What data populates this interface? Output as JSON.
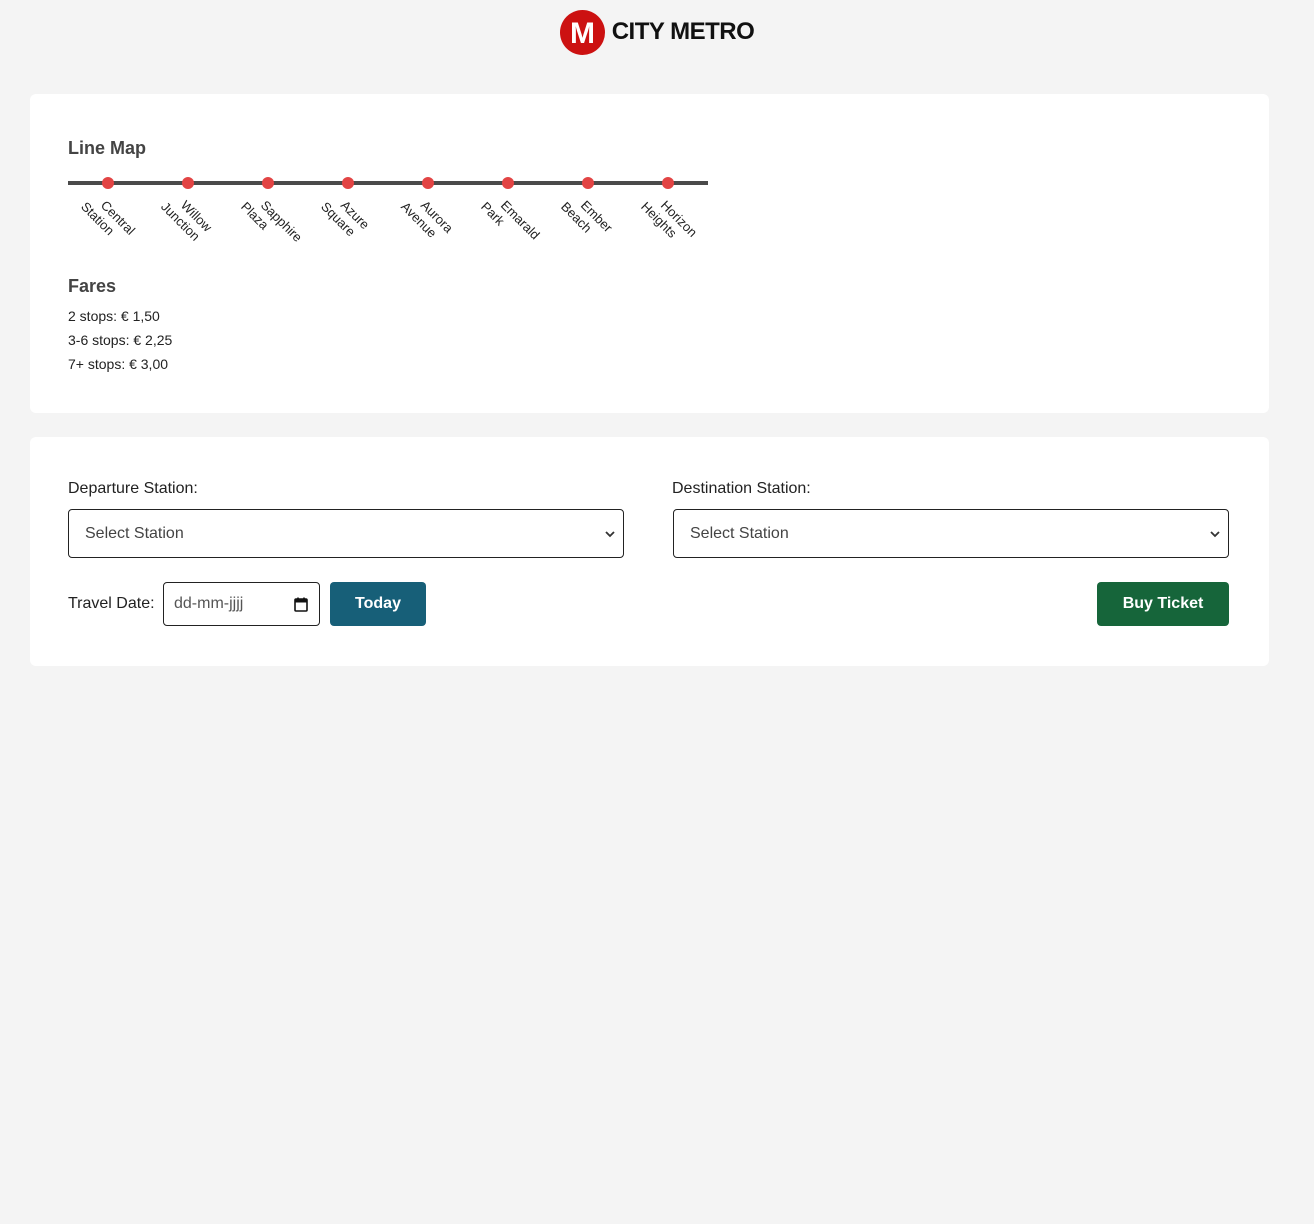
{
  "header": {
    "logo_letter": "M",
    "brand": "CITY METRO"
  },
  "line_map": {
    "title": "Line Map",
    "line_color": "#4a4a4a",
    "stop_color": "#e24444",
    "stations": [
      [
        "Central",
        "Station"
      ],
      [
        "Willow",
        "Junction"
      ],
      [
        "Sapphire",
        "Plaza"
      ],
      [
        "Azure",
        "Square"
      ],
      [
        "Aurora",
        "Avenue"
      ],
      [
        "Emarald",
        "Park"
      ],
      [
        "Ember",
        "Beach"
      ],
      [
        "Horizon",
        "Heights"
      ]
    ]
  },
  "fares": {
    "title": "Fares",
    "items": [
      "2 stops: € 1,50",
      "3-6 stops: € 2,25",
      "7+ stops: € 3,00"
    ]
  },
  "form": {
    "departure_label": "Departure Station:",
    "departure_value": "Select Station",
    "destination_label": "Destination Station:",
    "destination_value": "Select Station",
    "travel_date_label": "Travel Date:",
    "date_placeholder": "dd-mm-jjjj",
    "today_label": "Today",
    "buy_label": "Buy Ticket"
  },
  "colors": {
    "brand_red": "#cc1111",
    "today_button": "#175f78",
    "buy_button": "#16653a"
  }
}
